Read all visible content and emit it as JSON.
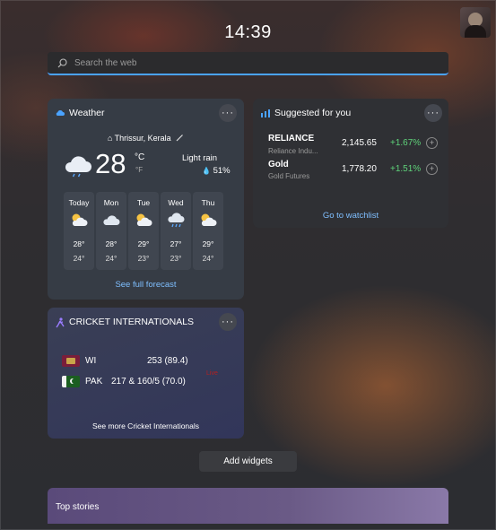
{
  "clock": "14:39",
  "search": {
    "placeholder": "Search the web"
  },
  "weather": {
    "title": "Weather",
    "location": "Thrissur, Kerala",
    "temp": "28",
    "unit_c": "°C",
    "unit_f": "°F",
    "condition": "Light rain",
    "humidity": "51%",
    "forecast": [
      {
        "day": "Today",
        "icon": "partly-sunny-icon",
        "hi": "28°",
        "lo": "24°"
      },
      {
        "day": "Mon",
        "icon": "cloudy-icon",
        "hi": "28°",
        "lo": "24°"
      },
      {
        "day": "Tue",
        "icon": "partly-sunny-icon",
        "hi": "29°",
        "lo": "23°"
      },
      {
        "day": "Wed",
        "icon": "rain-cloud-icon",
        "hi": "27°",
        "lo": "23°"
      },
      {
        "day": "Thu",
        "icon": "partly-sunny-icon",
        "hi": "29°",
        "lo": "24°"
      }
    ],
    "link": "See full forecast"
  },
  "suggested": {
    "title": "Suggested for you",
    "stocks": [
      {
        "name": "RELIANCE",
        "sub": "Reliance Indu...",
        "value": "2,145.65",
        "change": "+1.67%"
      },
      {
        "name": "Gold",
        "sub": "Gold Futures",
        "value": "1,778.20",
        "change": "+1.51%"
      }
    ],
    "link": "Go to watchlist"
  },
  "cricket": {
    "title": "CRICKET INTERNATIONALS",
    "teams": [
      {
        "code": "WI",
        "score": "253 (89.4)"
      },
      {
        "code": "PAK",
        "score": "217 & 160/5 (70.0)"
      }
    ],
    "status": "Live",
    "link": "See more Cricket Internationals"
  },
  "add_widgets": "Add widgets",
  "top_stories": "Top stories",
  "colors": {
    "accent": "#4aa3ff",
    "positive": "#5fd37a",
    "link": "#7fbfff"
  }
}
